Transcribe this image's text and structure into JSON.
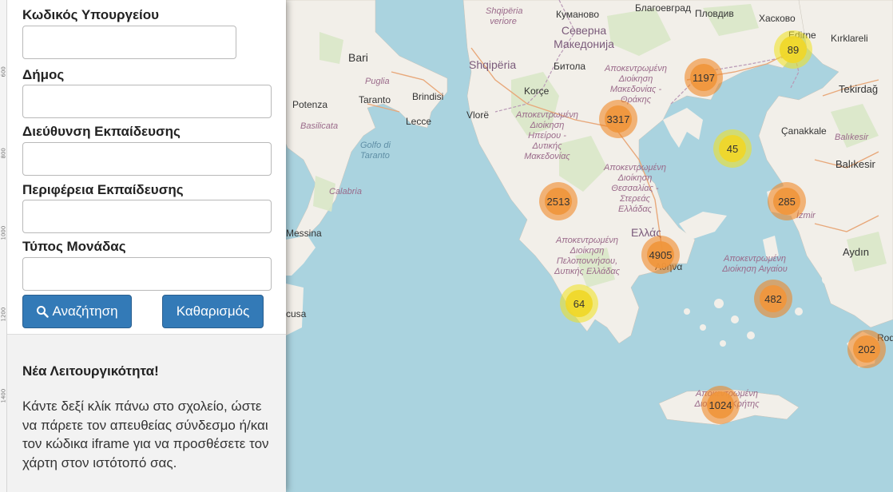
{
  "form": {
    "labels": {
      "ministry_code": "Κωδικός Υπουργείου",
      "municipality": "Δήμος",
      "education_directorate": "Διεύθυνση Εκπαίδευσης",
      "education_region": "Περιφέρεια Εκπαίδευσης",
      "unit_type": "Τύπος Μονάδας"
    },
    "values": {
      "ministry_code": "",
      "municipality": "",
      "education_directorate": "",
      "education_region": "",
      "unit_type": ""
    },
    "buttons": {
      "search": "Αναζήτηση",
      "clear": "Καθαρισμός"
    }
  },
  "ruler": [
    "600",
    "800",
    "1000",
    "1200",
    "1400"
  ],
  "news": {
    "title": "Νέα Λειτουργικότητα!",
    "body": "Κάντε δεξί κλίκ πάνω στο σχολείο, ώστε να πάρετε τον απευθείας σύνδεσμο ή/και τον κώδικα iframe για να προσθέσετε τον χάρτη στον ιστότοπό σας."
  },
  "clusters": [
    {
      "id": "c89",
      "count": "89",
      "color": "yellow"
    },
    {
      "id": "c1197",
      "count": "1197",
      "color": "orange"
    },
    {
      "id": "c3317",
      "count": "3317",
      "color": "orange"
    },
    {
      "id": "c45",
      "count": "45",
      "color": "yellow"
    },
    {
      "id": "c2513",
      "count": "2513",
      "color": "orange"
    },
    {
      "id": "c285",
      "count": "285",
      "color": "orange"
    },
    {
      "id": "c4905",
      "count": "4905",
      "color": "orange"
    },
    {
      "id": "c482",
      "count": "482",
      "color": "orange"
    },
    {
      "id": "c64",
      "count": "64",
      "color": "yellow"
    },
    {
      "id": "c202",
      "count": "202",
      "color": "orange"
    },
    {
      "id": "c1024",
      "count": "1024",
      "color": "orange"
    }
  ],
  "map_labels": {
    "bari": "Bari",
    "puglia": "Puglia",
    "taranto": "Taranto",
    "brindisi": "Brindisi",
    "lecce": "Lecce",
    "potenza": "Potenza",
    "basilicata": "Basilicata",
    "golfo": "Golfo di Taranto",
    "calabria": "Calabria",
    "messina": "Messina",
    "cusa": "cusa",
    "shqiperia_v": "Shqipëria veriore",
    "shqiperia": "Shqipëria",
    "kumanovo": "Куманово",
    "blagoevgrad": "Благоевград",
    "plovdiv": "Пловдив",
    "haskovo": "Хасково",
    "edirne": "Edirne",
    "kirklareli": "Kırklareli",
    "severna": "Северна Македонија",
    "bitola": "Битола",
    "korce": "Korçe",
    "vlore": "Vlorë",
    "tekirdag": "Tekirdağ",
    "canakkale": "Çanakkale",
    "balikesir_region": "Balıkesir",
    "balikesir": "Balıkesir",
    "izmir": "İzmir",
    "aydin": "Aydın",
    "ellada": "Ελλάς",
    "athina": "Αθήνα",
    "rodos": "Rodos",
    "region_amth": "Αποκεντρωμένη Διοίκηση Μακεδονίας - Θράκης",
    "region_hpeirou": "Αποκεντρωμένη Διοίκηση Ηπείρου - Δυτικής Μακεδονίας",
    "region_thessalias": "Αποκεντρωμένη Διοίκηση Θεσσαλίας - Στερεάς Ελλάδας",
    "region_peloponnisou": "Αποκεντρωμένη Διοίκηση Πελοποννήσου, Δυτικής Ελλάδας",
    "region_aigaiou": "Αποκεντρωμένη Διοίκηση Αιγαίου",
    "region_kritis": "Αποκεντρωμένη Διοίκηση Κρήτης"
  }
}
